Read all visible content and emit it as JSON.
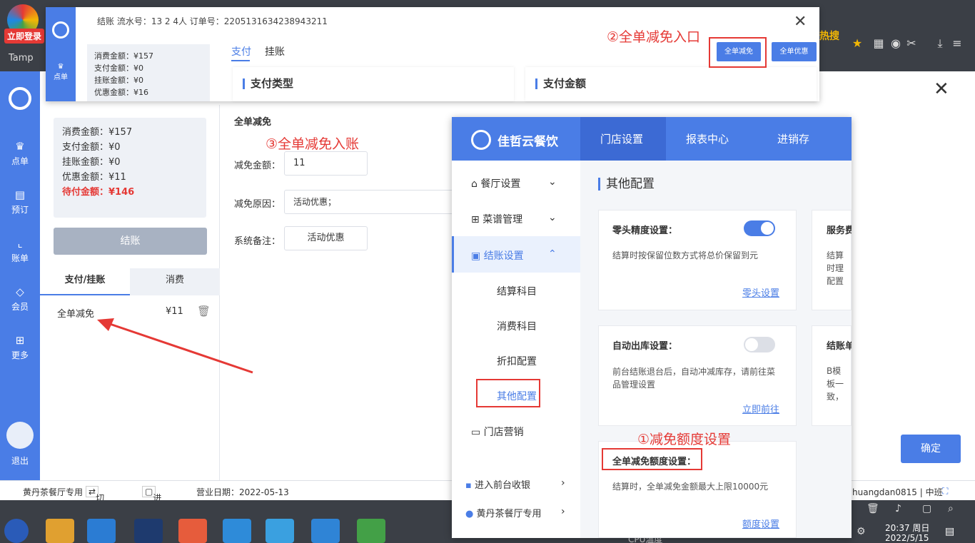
{
  "browser": {
    "login_badge": "立即登录",
    "tab_label": "Tamp",
    "hot_label": "热搜"
  },
  "nav": {
    "items": [
      {
        "label": "点单",
        "icon": "crown-icon"
      },
      {
        "label": "预订",
        "icon": "calendar-icon"
      },
      {
        "label": "账单",
        "icon": "chart-icon"
      },
      {
        "label": "会员",
        "icon": "diamond-icon"
      },
      {
        "label": "更多",
        "icon": "grid-icon"
      }
    ],
    "logout": "退出"
  },
  "popup": {
    "header": "结账 流水号：13 2 4人 订单号：2205131634238943211",
    "summary": [
      "消费金额：¥157",
      "支付金额：¥0",
      "挂账金额：¥0",
      "优惠金额：¥16"
    ],
    "tabs": [
      "支付",
      "挂账"
    ],
    "btn_full_discount": "全单减免",
    "btn_full_promo": "全单优惠",
    "card_pay_type": "支付类型",
    "card_pay_amount": "支付金额",
    "nav_label": "点单"
  },
  "summary": {
    "consume": "消费金额：¥157",
    "paid": "支付金额：¥0",
    "hang": "挂账金额：¥0",
    "discount": "优惠金额：¥11",
    "due": "待付金额：¥146"
  },
  "checkout_btn": "结账",
  "left_tabs": [
    "支付/挂账",
    "消费"
  ],
  "record": {
    "name": "全单减免",
    "amount": "¥11"
  },
  "form": {
    "title": "全单减免",
    "amount_label": "减免金额：",
    "amount_value": "11",
    "reason_label": "减免原因：",
    "reason_value": "活动优惠；",
    "remark_label": "系统备注：",
    "remark_value": "活动优惠"
  },
  "confirm_btn": "确定",
  "status": {
    "store": "黄丹茶餐厅专用",
    "switch": "切换餐厅",
    "backend": "进入后台",
    "date": "营业日期：2022-05-13",
    "user": "huangdan0815 | 中班"
  },
  "taskbar": {
    "time": "20:37 周日",
    "date": "2022/5/15",
    "cpu": "CPU温度"
  },
  "settings": {
    "brand": "佳哲云餐饮",
    "tabs": [
      "门店设置",
      "报表中心",
      "进销存"
    ],
    "side": [
      {
        "label": "餐厅设置",
        "icon": "home-icon"
      },
      {
        "label": "菜谱管理",
        "icon": "grid-icon"
      },
      {
        "label": "结账设置",
        "icon": "receipt-icon"
      },
      {
        "label": "结算科目"
      },
      {
        "label": "消费科目"
      },
      {
        "label": "折扣配置"
      },
      {
        "label": "其他配置"
      },
      {
        "label": "门店营销",
        "icon": "shop-icon"
      },
      {
        "label": "进入前台收银",
        "icon": "cashier-icon"
      },
      {
        "label": "黄丹茶餐厅专用",
        "icon": "location-icon"
      }
    ],
    "heading": "其他配置",
    "cards": [
      {
        "title": "零头精度设置：",
        "desc": "结算时按保留位数方式将总价保留到元",
        "link": "零头设置",
        "toggle": true
      },
      {
        "title": "服务费",
        "desc": "结算时理配置"
      },
      {
        "title": "自动出库设置：",
        "desc": "前台结账退台后，自动冲减库存，请前往菜品管理设置",
        "link": "立即前往",
        "toggle": false
      },
      {
        "title": "结账单",
        "desc": "B模板一致，"
      },
      {
        "title": "全单减免额度设置：",
        "desc": "结算时，全单减免金额最大上限10000元",
        "link": "额度设置"
      }
    ]
  },
  "annotations": {
    "a1": "①减免额度设置",
    "a2": "②全单减免入口",
    "a3": "③全单减免入账"
  },
  "colors": {
    "primary": "#4a7de6",
    "annotation": "#e53935"
  }
}
